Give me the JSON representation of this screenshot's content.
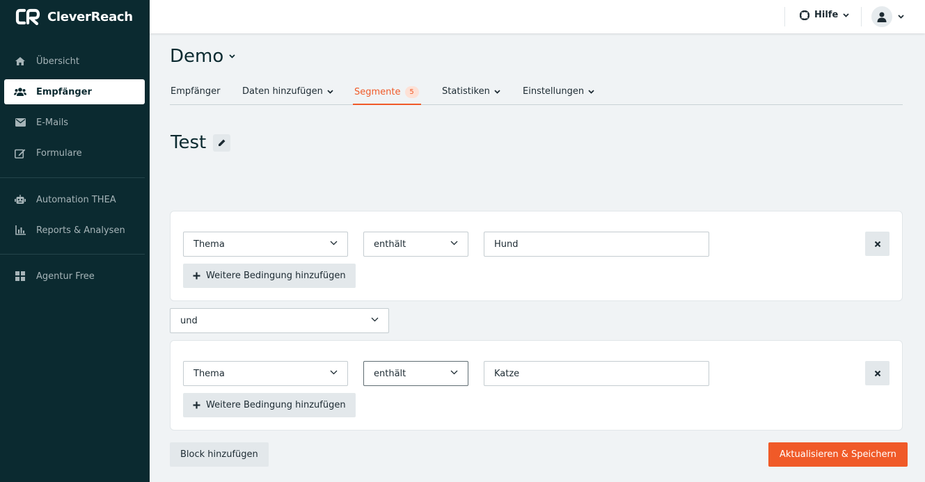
{
  "brand": {
    "name": "CleverReach",
    "accent": "#f05a28",
    "sidebar_bg": "#0b2a30"
  },
  "sidebar": {
    "items": [
      {
        "label": "Übersicht",
        "icon": "home-icon"
      },
      {
        "label": "Empfänger",
        "icon": "users-icon",
        "active": true
      },
      {
        "label": "E-Mails",
        "icon": "envelope-icon"
      },
      {
        "label": "Formulare",
        "icon": "form-edit-icon"
      },
      {
        "label": "Automation THEA",
        "icon": "robot-icon"
      },
      {
        "label": "Reports & Analysen",
        "icon": "bar-chart-icon"
      },
      {
        "label": "Agentur Free",
        "icon": "grid-icon"
      }
    ]
  },
  "topbar": {
    "help_label": "Hilfe"
  },
  "header": {
    "title": "Demo"
  },
  "tabs": [
    {
      "label": "Empfänger"
    },
    {
      "label": "Daten hinzufügen"
    },
    {
      "label": "Segmente",
      "badge": "5",
      "active": true
    },
    {
      "label": "Statistiken"
    },
    {
      "label": "Einstellungen"
    }
  ],
  "segment": {
    "title": "Test"
  },
  "blocks": [
    {
      "field": "Thema",
      "operator": "enthält",
      "value": "Hund",
      "add_condition_label": "Weitere Bedingung hinzufügen"
    },
    {
      "field": "Thema",
      "operator": "enthält",
      "value": "Katze",
      "add_condition_label": "Weitere Bedingung hinzufügen"
    }
  ],
  "connector": {
    "value": "und"
  },
  "actions": {
    "add_block_label": "Block hinzufügen",
    "save_label": "Aktualisieren & Speichern"
  }
}
